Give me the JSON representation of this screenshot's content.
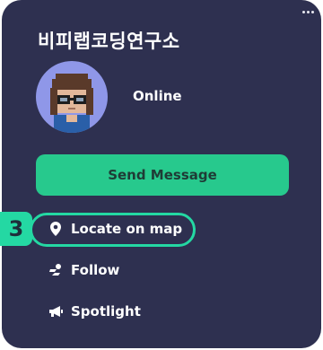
{
  "profile": {
    "name": "비피랩코딩연구소",
    "status": "Online"
  },
  "actions": {
    "send_message": "Send Message",
    "locate_on_map": "Locate on map",
    "follow": "Follow",
    "spotlight": "Spotlight"
  },
  "annotation": {
    "step_number": "3"
  },
  "icons": {
    "menu": "more-horizontal-icon",
    "locate": "map-pin-icon",
    "follow": "follow-runner-icon",
    "spotlight": "megaphone-icon"
  },
  "colors": {
    "card_background": "#2e3050",
    "accent_green": "#27c98d",
    "highlight_teal": "#24d8a3",
    "avatar_background": "#8f97e8"
  }
}
